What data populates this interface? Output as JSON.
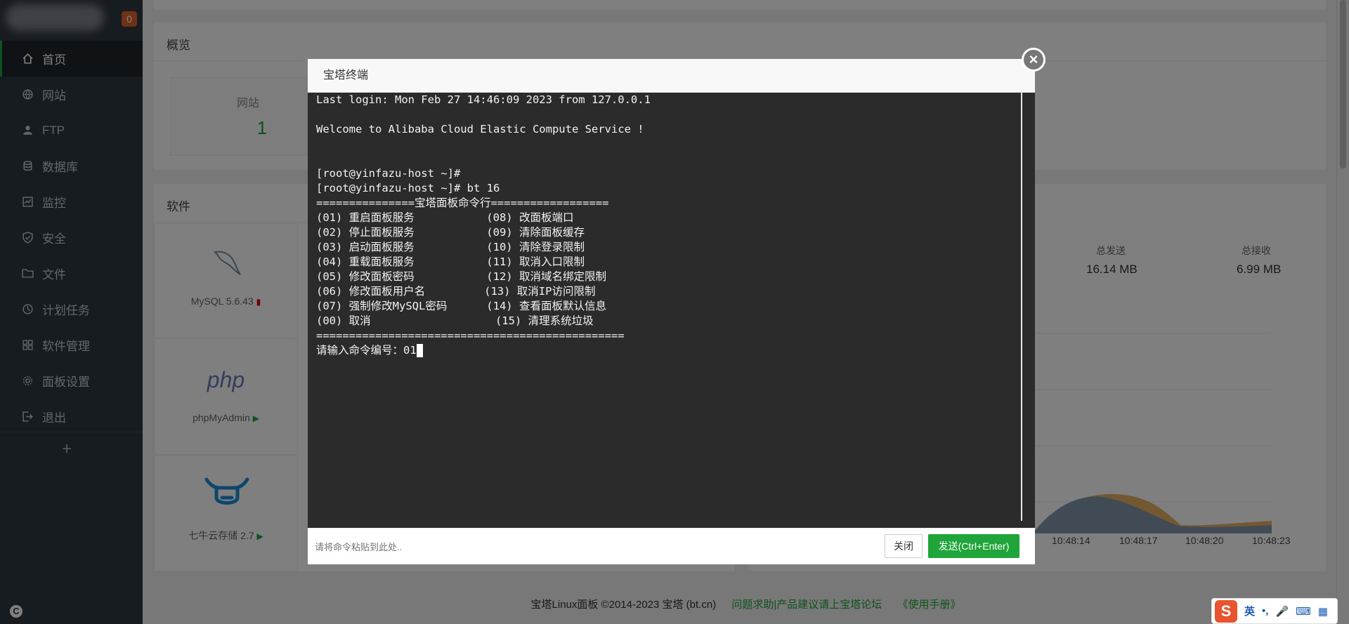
{
  "sidebar": {
    "badge": "0",
    "items": [
      {
        "label": "首页",
        "icon": "home-icon",
        "active": true
      },
      {
        "label": "网站",
        "icon": "globe-icon"
      },
      {
        "label": "FTP",
        "icon": "user-icon"
      },
      {
        "label": "数据库",
        "icon": "database-icon"
      },
      {
        "label": "监控",
        "icon": "monitor-icon"
      },
      {
        "label": "安全",
        "icon": "shield-icon"
      },
      {
        "label": "文件",
        "icon": "folder-icon"
      },
      {
        "label": "计划任务",
        "icon": "clock-icon"
      },
      {
        "label": "软件管理",
        "icon": "apps-icon"
      },
      {
        "label": "面板设置",
        "icon": "gear-icon"
      },
      {
        "label": "退出",
        "icon": "logout-icon"
      }
    ],
    "add_label": "+"
  },
  "overview": {
    "title": "概览",
    "site_label": "网站",
    "site_count": "1"
  },
  "software": {
    "title": "软件",
    "items": [
      {
        "name": "MySQL 5.6.43"
      },
      {
        "name": "phpMyAdmin"
      },
      {
        "name": "七牛云存储 2.7"
      }
    ],
    "php_logo_text": "php"
  },
  "traffic": {
    "sent_label": "总发送",
    "sent_value": "16.14 MB",
    "recv_label": "总接收",
    "recv_value": "6.99 MB",
    "ticks": [
      "10:48:14",
      "10:48:17",
      "10:48:20",
      "10:48:23"
    ]
  },
  "modal": {
    "title": "宝塔终端",
    "close_x": "×",
    "terminal_lines": [
      "Last login: Mon Feb 27 14:46:09 2023 from 127.0.0.1",
      "",
      "Welcome to Alibaba Cloud Elastic Compute Service !",
      "",
      "",
      "[root@yinfazu-host ~]#",
      "[root@yinfazu-host ~]# bt 16",
      "===============宝塔面板命令行==================",
      "(01) 重启面板服务           (08) 改面板端口",
      "(02) 停止面板服务           (09) 清除面板缓存",
      "(03) 启动面板服务           (10) 清除登录限制",
      "(04) 重载面板服务           (11) 取消入口限制",
      "(05) 修改面板密码           (12) 取消域名绑定限制",
      "(06) 修改面板用户名         (13) 取消IP访问限制",
      "(07) 强制修改MySQL密码      (14) 查看面板默认信息",
      "(00) 取消                   (15) 清理系统垃圾",
      "==============================================="
    ],
    "prompt_line": "请输入命令编号：01",
    "input_placeholder": "请将命令粘贴到此处..",
    "close_button": "关闭",
    "send_button": "发送(Ctrl+Enter)"
  },
  "footer": {
    "copyright": "宝塔Linux面板 ©2014-2023 宝塔 (bt.cn)",
    "link1": "问题求助|产品建议请上宝塔论坛",
    "link2": "《使用手册》"
  },
  "ime": {
    "logo": "S",
    "lang": "英"
  }
}
